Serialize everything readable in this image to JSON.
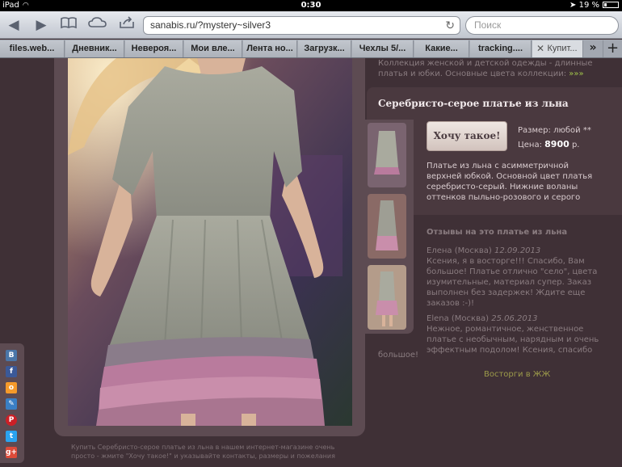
{
  "status_bar": {
    "device": "iPad",
    "time": "0:30",
    "battery": "19 %"
  },
  "toolbar": {
    "url": "sanabis.ru/?mystery~silver3",
    "search_placeholder": "Поиск"
  },
  "tabs": [
    {
      "label": "files.web..."
    },
    {
      "label": "Дневник..."
    },
    {
      "label": "Невероя..."
    },
    {
      "label": "Мои вле..."
    },
    {
      "label": "Лента но..."
    },
    {
      "label": "Загрузк..."
    },
    {
      "label": "Чехлы 5/..."
    },
    {
      "label": "Какие..."
    },
    {
      "label": "tracking...."
    },
    {
      "label": "Купит..."
    }
  ],
  "collection": {
    "text": "Коллекция женской и детской одежды - длинные платья и юбки. Основные цвета коллекции:",
    "arrows": "»»»"
  },
  "product": {
    "title": "Серебристо-серое платье из льна",
    "button": "Хочу такое!",
    "size_label": "Размер:",
    "size_value": "любой",
    "size_mark": "**",
    "price_label": "Цена:",
    "price_value": "8900",
    "price_unit": "р.",
    "description": "Платье из льна с асимметричной верхней юбкой. Основной цвет платья серебристо-серый. Нижние воланы оттенков пыльно-розового и серого"
  },
  "reviews": {
    "heading": "Отзывы на это платье из льна",
    "items": [
      {
        "author": "Елена (Москва)",
        "date": "12.09.2013",
        "text": "Ксения, я в восторге!!! Спасибо, Вам большое! Платье отлично \"село\", цвета изумительные, материал супер. Заказ выполнен без задержек! Ждите еще заказов :-)!"
      },
      {
        "author": "Elena (Москва)",
        "date": "25.06.2013",
        "text": "Нежное, романтичное, женственное платье с необычным, нарядным и очень эффектным подолом! Ксения, спасибо",
        "tail": "большое!"
      }
    ],
    "lj_link": "Восторги в ЖЖ"
  },
  "footer": {
    "text": "Купить Серебристо-серое платье из льна в нашем интернет-магазине очень просто - жмите \"Хочу такое!\" и указывайте контакты, размеры и пожелания"
  },
  "social": {
    "icons": [
      "vk-icon",
      "facebook-icon",
      "odnoklassniki-icon",
      "livejournal-icon",
      "pinterest-icon",
      "twitter-icon",
      "google-plus-icon"
    ],
    "glyphs": [
      "В",
      "f",
      "о",
      "✎",
      "P",
      "t",
      "g+"
    ],
    "colors": [
      "#4a76a8",
      "#3b5998",
      "#f59a2a",
      "#3a7fc4",
      "#cb2027",
      "#2aa3ef",
      "#dd4b39"
    ]
  }
}
